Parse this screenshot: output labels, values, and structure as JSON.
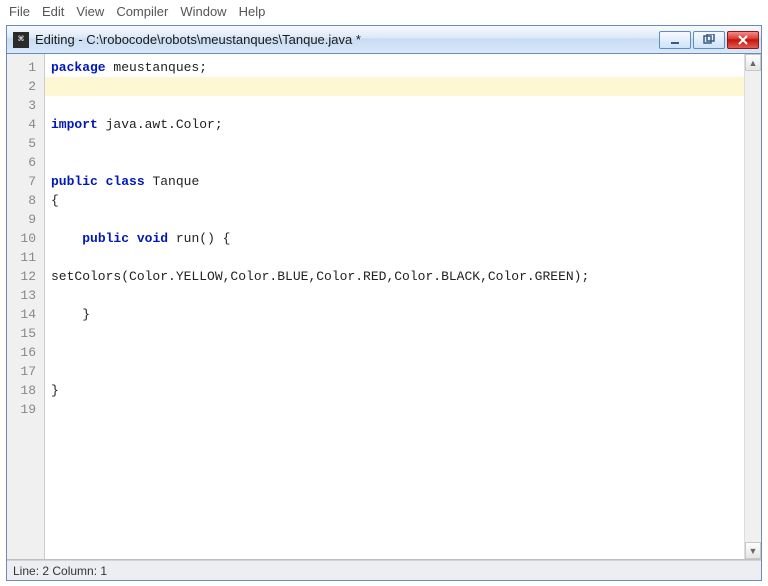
{
  "menu": {
    "items": [
      "File",
      "Edit",
      "View",
      "Compiler",
      "Window",
      "Help"
    ]
  },
  "window": {
    "title": "Editing - C:\\robocode\\robots\\meustanques\\Tanque.java *"
  },
  "editor": {
    "highlight_line_index": 1,
    "lines": [
      [
        {
          "t": "kw",
          "s": "package"
        },
        {
          "t": "plain",
          "s": " meustanques;"
        }
      ],
      [],
      [],
      [
        {
          "t": "kw",
          "s": "import"
        },
        {
          "t": "plain",
          "s": " java.awt.Color;"
        }
      ],
      [],
      [],
      [
        {
          "t": "kw",
          "s": "public"
        },
        {
          "t": "plain",
          "s": " "
        },
        {
          "t": "kw",
          "s": "class"
        },
        {
          "t": "plain",
          "s": " Tanque"
        }
      ],
      [
        {
          "t": "plain",
          "s": "{"
        }
      ],
      [],
      [
        {
          "t": "plain",
          "s": "    "
        },
        {
          "t": "kw",
          "s": "public"
        },
        {
          "t": "plain",
          "s": " "
        },
        {
          "t": "kw",
          "s": "void"
        },
        {
          "t": "plain",
          "s": " run() {"
        }
      ],
      [],
      [
        {
          "t": "plain",
          "s": "setColors(Color.YELLOW,Color.BLUE,Color.RED,Color.BLACK,Color.GREEN);"
        }
      ],
      [],
      [
        {
          "t": "plain",
          "s": "    }"
        }
      ],
      [],
      [],
      [],
      [
        {
          "t": "plain",
          "s": "}"
        }
      ],
      []
    ]
  },
  "status": {
    "text": "Line: 2 Column: 1"
  }
}
